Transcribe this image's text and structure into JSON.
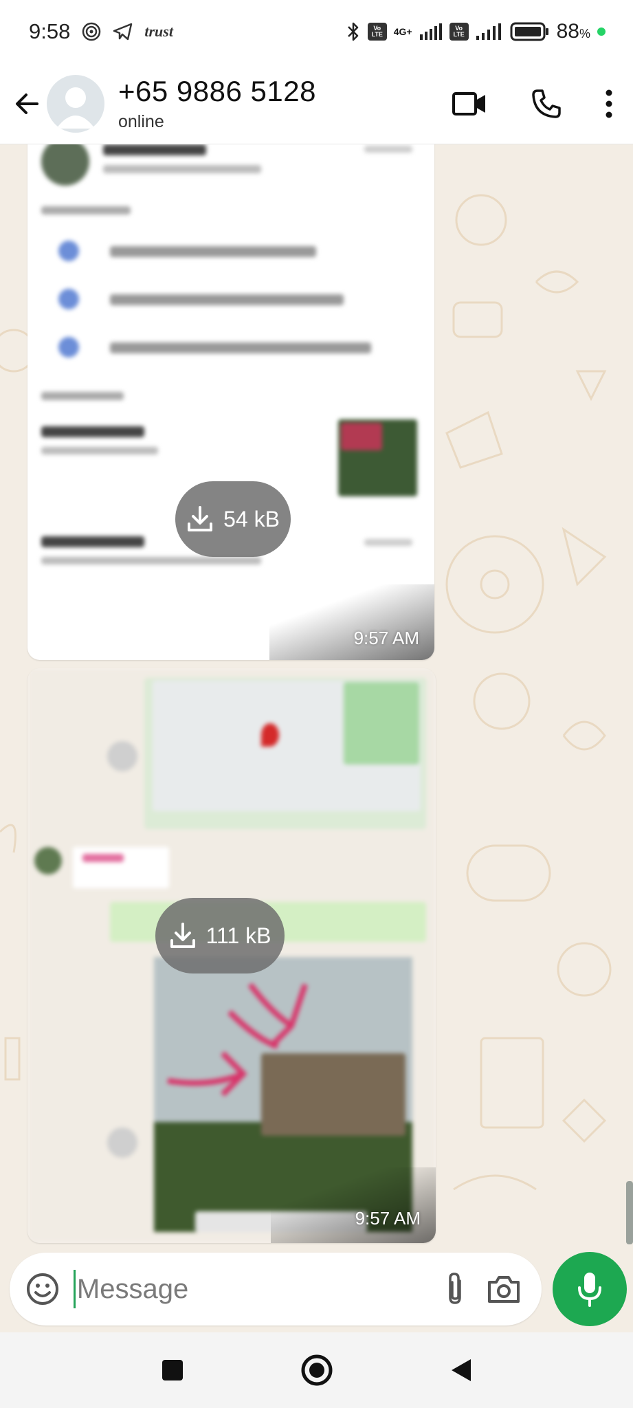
{
  "status_bar": {
    "time": "9:58",
    "app_label": "trust",
    "net_type_1": "4G+",
    "lte_badge": "LTE",
    "battery": "88",
    "battery_unit": "%"
  },
  "header": {
    "contact_name": "+65 9886 5128",
    "contact_status": "online"
  },
  "messages": [
    {
      "type": "image",
      "download_size": "54 kB",
      "time": "9:57 AM"
    },
    {
      "type": "image",
      "download_size": "111 kB",
      "time": "9:57 AM"
    }
  ],
  "composer": {
    "placeholder": "Message"
  },
  "colors": {
    "accent_green": "#1da851",
    "wallpaper": "#f3ede4",
    "bubble": "#ffffff"
  },
  "icons": {
    "back": "arrow-left-icon",
    "video": "video-camera-icon",
    "call": "phone-icon",
    "menu": "more-vertical-icon",
    "emoji": "emoji-icon",
    "attach": "paperclip-icon",
    "camera": "camera-icon",
    "mic": "microphone-icon",
    "download": "download-icon"
  }
}
